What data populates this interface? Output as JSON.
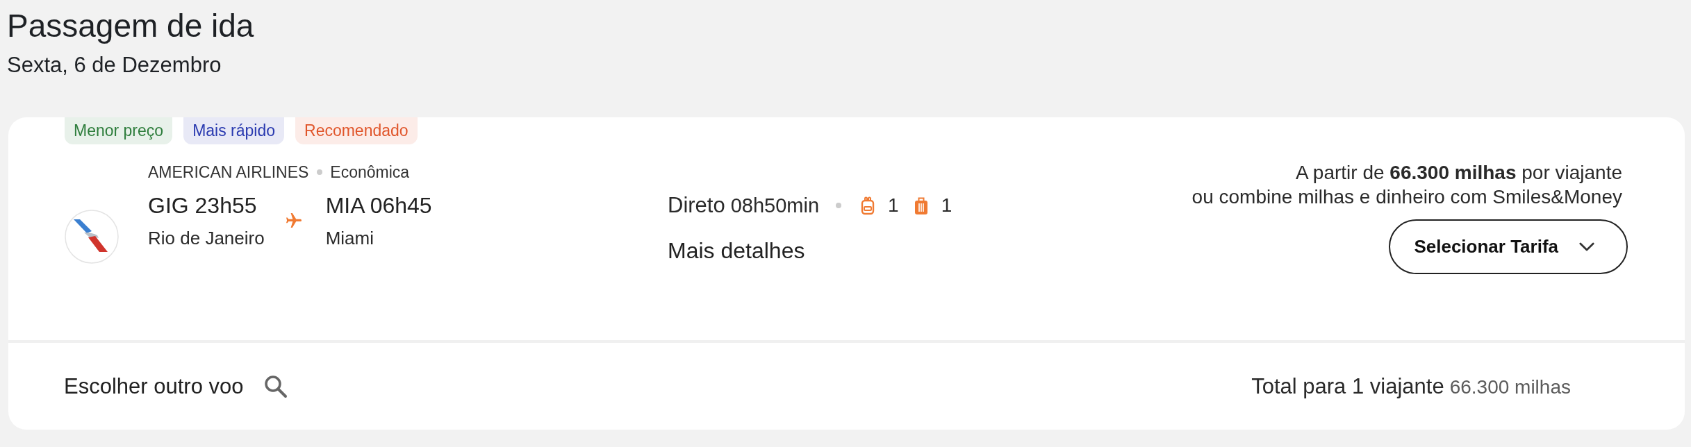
{
  "header": {
    "title": "Passagem de ida",
    "date": "Sexta, 6 de Dezembro"
  },
  "flight_card": {
    "badges": [
      {
        "label": "Menor preço",
        "color": "#2e7d3c"
      },
      {
        "label": "Mais rápido",
        "color": "#2a3ab0"
      },
      {
        "label": "Recomendado",
        "color": "#e0552a"
      }
    ],
    "airline": "AMERICAN AIRLINES",
    "cabin": "Econômica",
    "departure": {
      "airport_time": "GIG 23h55",
      "city": "Rio de Janeiro"
    },
    "arrival": {
      "airport_time": "MIA 06h45",
      "city": "Miami"
    },
    "stops": "Direto",
    "duration": "08h50min",
    "baggage": [
      {
        "kind": "backpack",
        "count": "1"
      },
      {
        "kind": "suitcase",
        "count": "1"
      }
    ],
    "details_link": "Mais detalhes",
    "price_text": "A partir de **66.300 milhas** por viajante",
    "combine_note": "ou combine milhas e dinheiro com Smiles&Money",
    "select_button": "Selecionar Tarifa",
    "footer": {
      "other_flight_button": "Escolher outro voo",
      "total_label": "Total para 1 viajante",
      "total_value": "66.300 milhas"
    }
  }
}
